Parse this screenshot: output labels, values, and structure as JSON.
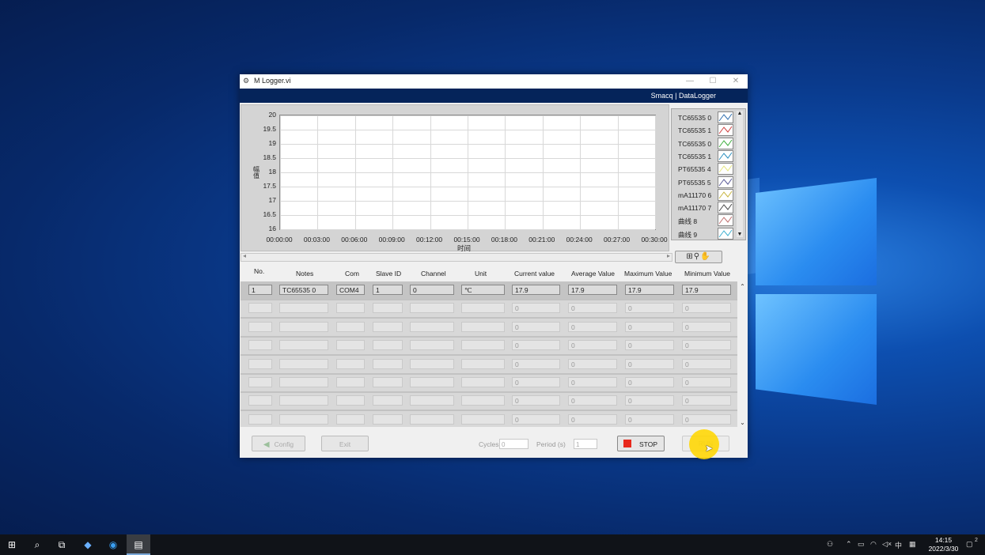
{
  "window": {
    "title": "M Logger.vi",
    "brand": "Smacq | DataLogger",
    "controls": {
      "minimize": "—",
      "maximize": "☐",
      "close": "✕"
    }
  },
  "chart_data": {
    "type": "line",
    "ylabel": "幅值",
    "xlabel": "时间",
    "yticks": [
      "20",
      "19.5",
      "19",
      "18.5",
      "18",
      "17.5",
      "17",
      "16.5",
      "16"
    ],
    "xticks": [
      "00:00:00",
      "00:03:00",
      "00:06:00",
      "00:09:00",
      "00:12:00",
      "00:15:00",
      "00:18:00",
      "00:21:00",
      "00:24:00",
      "00:27:00",
      "00:30:00"
    ],
    "ylim": [
      16,
      20
    ],
    "xlim": [
      "00:00:00",
      "00:30:00"
    ],
    "grid": true,
    "series": [
      {
        "name": "TC65535 0",
        "color": "#2f6fb0",
        "values": []
      },
      {
        "name": "TC65535 1",
        "color": "#d04040",
        "values": []
      },
      {
        "name": "TC65535 0",
        "color": "#3fae3f",
        "values": []
      },
      {
        "name": "TC65535 1",
        "color": "#2b8fbf",
        "values": []
      },
      {
        "name": "PT65535 4",
        "color": "#e6e680",
        "values": []
      },
      {
        "name": "PT65535 5",
        "color": "#5a5a9a",
        "values": []
      },
      {
        "name": "mA11170 6",
        "color": "#c8b640",
        "values": []
      },
      {
        "name": "mA11170 7",
        "color": "#4a4a4a",
        "values": []
      },
      {
        "name": "曲线 8",
        "color": "#c07070",
        "values": []
      },
      {
        "name": "曲线 9",
        "color": "#40b0d0",
        "values": []
      }
    ]
  },
  "legend": {
    "scroll_up": "▲",
    "scroll_down": "▼"
  },
  "graph_tools": {
    "label": "⊞⚲✋"
  },
  "table": {
    "headers": [
      "No.",
      "Notes",
      "Com",
      "Slave ID",
      "Channel",
      "Unit",
      "Current value",
      "Average Value",
      "Maximum Value",
      "Minimum Value"
    ],
    "rows": [
      [
        "1",
        "TC65535 0",
        "COM4",
        "1",
        "0",
        "℃",
        "17.9",
        "17.9",
        "17.9",
        "17.9"
      ],
      [
        "",
        "",
        "",
        "",
        "",
        "",
        "0",
        "0",
        "0",
        "0"
      ],
      [
        "",
        "",
        "",
        "",
        "",
        "",
        "0",
        "0",
        "0",
        "0"
      ],
      [
        "",
        "",
        "",
        "",
        "",
        "",
        "0",
        "0",
        "0",
        "0"
      ],
      [
        "",
        "",
        "",
        "",
        "",
        "",
        "0",
        "0",
        "0",
        "0"
      ],
      [
        "",
        "",
        "",
        "",
        "",
        "",
        "0",
        "0",
        "0",
        "0"
      ],
      [
        "",
        "",
        "",
        "",
        "",
        "",
        "0",
        "0",
        "0",
        "0"
      ],
      [
        "",
        "",
        "",
        "",
        "",
        "",
        "0",
        "0",
        "0",
        "0"
      ]
    ],
    "scroll_up": "⌃",
    "scroll_down": "⌄"
  },
  "hscroll": {
    "left": "◂",
    "right": "▸"
  },
  "controls": {
    "config_label": "Config",
    "exit_label": "Exit",
    "cycles_label": "Cycles",
    "cycles_value": "0",
    "period_label": "Period  (s)",
    "period_value": "1",
    "stop_label": "STOP",
    "run_label": "RUN"
  },
  "taskbar": {
    "time": "14:15",
    "date": "2022/3/30",
    "ime": "中",
    "notification_count": "2"
  }
}
